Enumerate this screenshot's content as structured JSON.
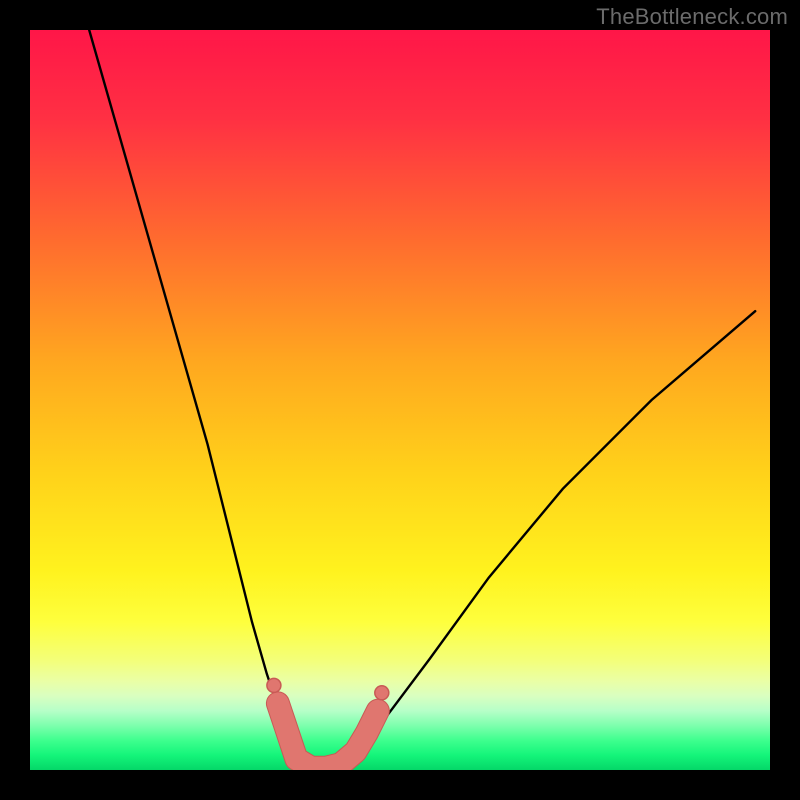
{
  "watermark": "TheBottleneck.com",
  "colors": {
    "frame": "#000000",
    "watermark_text": "#6b6b6b",
    "curve_stroke": "#000000",
    "marker_fill": "#e0766f",
    "marker_stroke": "#c85a55",
    "gradient_stops": [
      {
        "offset": "0%",
        "color": "#ff1648"
      },
      {
        "offset": "12%",
        "color": "#ff3043"
      },
      {
        "offset": "28%",
        "color": "#ff6a2f"
      },
      {
        "offset": "45%",
        "color": "#ffa81f"
      },
      {
        "offset": "60%",
        "color": "#ffd21a"
      },
      {
        "offset": "73%",
        "color": "#fff21e"
      },
      {
        "offset": "80%",
        "color": "#feff3d"
      },
      {
        "offset": "85%",
        "color": "#f4ff77"
      },
      {
        "offset": "88%",
        "color": "#eaffa6"
      },
      {
        "offset": "90%",
        "color": "#d9ffc0"
      },
      {
        "offset": "92%",
        "color": "#b6ffc8"
      },
      {
        "offset": "94%",
        "color": "#7dffad"
      },
      {
        "offset": "96%",
        "color": "#3eff8e"
      },
      {
        "offset": "98%",
        "color": "#14f57a"
      },
      {
        "offset": "100%",
        "color": "#05d768"
      }
    ]
  },
  "chart_data": {
    "type": "line",
    "title": "",
    "xlabel": "",
    "ylabel": "",
    "xlim": [
      0,
      100
    ],
    "ylim": [
      0,
      100
    ],
    "note": "Bottleneck-style V curve. y ~ percentage bottleneck (0 at minimum). x is an unlabeled parameter. Values estimated from pixel positions; no axis ticks present.",
    "series": [
      {
        "name": "curve",
        "x": [
          8,
          12,
          16,
          20,
          24,
          28,
          30,
          32,
          34,
          35,
          36,
          38,
          40,
          42,
          44,
          48,
          54,
          62,
          72,
          84,
          98
        ],
        "y": [
          100,
          86,
          72,
          58,
          44,
          28,
          20,
          13,
          7,
          3,
          1,
          0,
          0,
          0.5,
          2,
          7,
          15,
          26,
          38,
          50,
          62
        ]
      }
    ],
    "markers": {
      "name": "highlight-segment",
      "note": "Rounded salmon capsule tracing the bottom of the V plus two small dots on each rising side.",
      "points": [
        {
          "x": 33.5,
          "y": 9
        },
        {
          "x": 34.5,
          "y": 6
        },
        {
          "x": 36,
          "y": 1.5
        },
        {
          "x": 38,
          "y": 0.3
        },
        {
          "x": 40,
          "y": 0.3
        },
        {
          "x": 42,
          "y": 0.8
        },
        {
          "x": 44,
          "y": 2.5
        },
        {
          "x": 45.5,
          "y": 5
        },
        {
          "x": 47,
          "y": 8
        }
      ]
    }
  }
}
